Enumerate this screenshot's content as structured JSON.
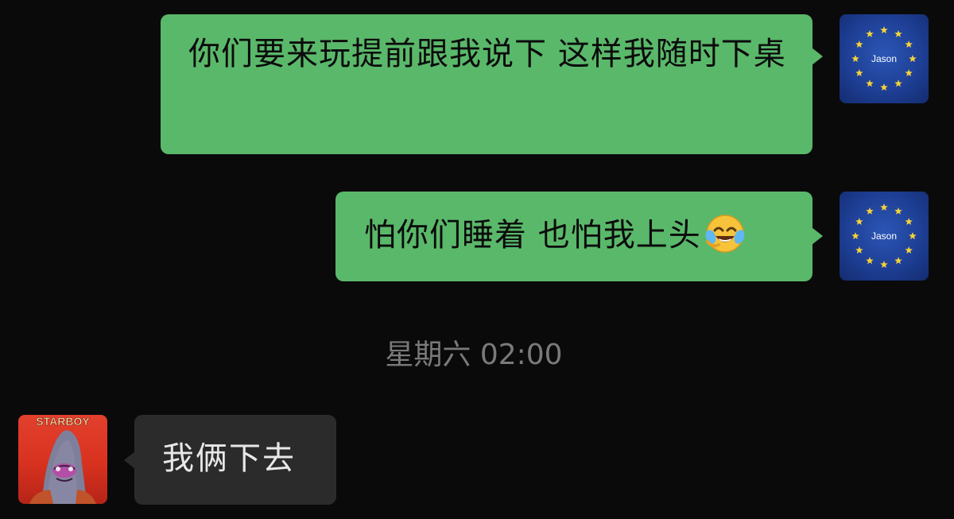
{
  "theme": {
    "green": "#5ab86a",
    "gray_bubble": "#2b2b2b",
    "background": "#0a0a0a"
  },
  "messages": [
    {
      "side": "right",
      "sender_avatar_label": "Jason",
      "text": "你们要来玩提前跟我说下 这样我随时下桌"
    },
    {
      "side": "right",
      "sender_avatar_label": "Jason",
      "text": "怕你们睡着 也怕我上头",
      "emoji": "laughing-crying-emoji"
    },
    {
      "side": "left",
      "sender_avatar_label": "STARBOY",
      "text": "我俩下去"
    }
  ],
  "timestamp": "星期六 02:00"
}
